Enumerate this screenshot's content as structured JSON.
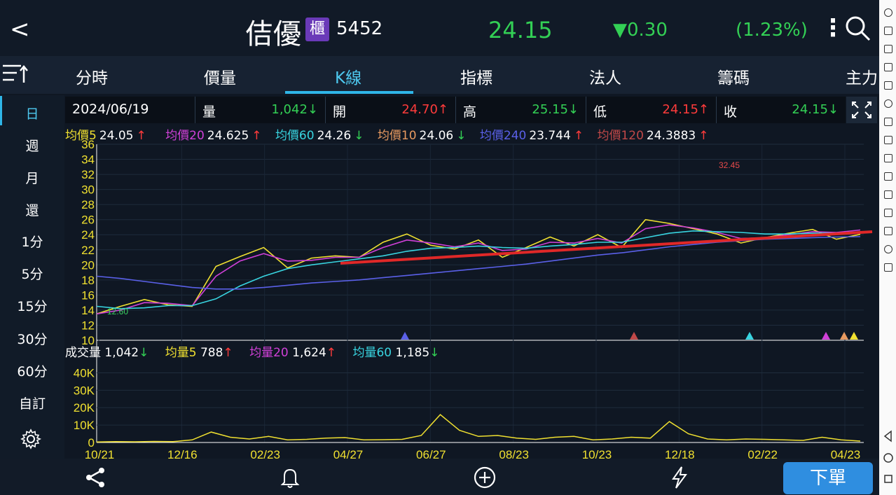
{
  "header": {
    "back": "<",
    "stock_name": "佶優",
    "market_badge": "櫃",
    "code": "5452",
    "price": "24.15",
    "change": "▼0.30",
    "change_pct": "(1.23%)"
  },
  "tabs": [
    "分時",
    "價量",
    "K線",
    "指標",
    "法人",
    "籌碼",
    "主力"
  ],
  "active_tab": "K線",
  "sidebar": [
    "日",
    "週",
    "月",
    "還",
    "1分",
    "5分",
    "15分",
    "30分",
    "60分",
    "自訂"
  ],
  "info": {
    "date": "2024/06/19",
    "volume_label": "量",
    "volume": "1,042↓",
    "open_label": "開",
    "open": "24.70↑",
    "high_label": "高",
    "high": "25.15↓",
    "low_label": "低",
    "low": "24.15↑",
    "close_label": "收",
    "close": "24.15↓"
  },
  "ma": [
    {
      "label": "均價5",
      "value": "24.05",
      "arrow": "↑",
      "color": "#f0e030"
    },
    {
      "label": "均價20",
      "value": "24.625",
      "arrow": "↑",
      "color": "#d040d8"
    },
    {
      "label": "均價60",
      "value": "24.26",
      "arrow": "↓",
      "color": "#38d4e0"
    },
    {
      "label": "均價10",
      "value": "24.06",
      "arrow": "↓",
      "color": "#e89a60"
    },
    {
      "label": "均價240",
      "value": "23.744",
      "arrow": "↑",
      "color": "#5a60e8"
    },
    {
      "label": "均價120",
      "value": "24.3883",
      "arrow": "↑",
      "color": "#c04848"
    }
  ],
  "volume_info": [
    {
      "label": "成交量",
      "value": "1,042",
      "arrow": "↓",
      "color": "#ffffff"
    },
    {
      "label": "均量5",
      "value": "788",
      "arrow": "↑",
      "color": "#f0e030"
    },
    {
      "label": "均量20",
      "value": "1,624",
      "arrow": "↑",
      "color": "#d040d8"
    },
    {
      "label": "均量60",
      "value": "1,185",
      "arrow": "↓",
      "color": "#38d4e0"
    }
  ],
  "bottom": {
    "order_label": "下單"
  },
  "chart_data": {
    "type": "line",
    "x_ticks": [
      "10/21",
      "12/16",
      "02/23",
      "04/27",
      "06/27",
      "08/23",
      "10/23",
      "12/18",
      "02/22",
      "04/23"
    ],
    "price_ticks": [
      "36",
      "34",
      "32",
      "30",
      "28",
      "26",
      "24",
      "22",
      "20",
      "18",
      "16",
      "14",
      "12",
      "10"
    ],
    "ylim": [
      10,
      36
    ],
    "annotations": [
      "32.45",
      "12.60"
    ],
    "volume_ticks": [
      "40K",
      "30K",
      "20K",
      "10K",
      "0"
    ],
    "volume_ylim": [
      0,
      45000
    ],
    "series": [
      {
        "name": "均價5",
        "values": [
          13.5,
          14.5,
          15.4,
          14.7,
          14.5,
          19.8,
          21.1,
          22.3,
          19.6,
          20.9,
          21.2,
          21.0,
          23.0,
          24.1,
          22.6,
          22.1,
          23.3,
          21.0,
          22.3,
          23.7,
          22.5,
          24.0,
          22.3,
          26.0,
          25.5,
          24.8,
          24.1,
          22.9,
          23.6,
          24.2,
          24.7,
          23.4,
          24.05
        ]
      },
      {
        "name": "均價20",
        "values": [
          13.5,
          14.0,
          15.0,
          14.9,
          14.6,
          18.5,
          20.5,
          21.5,
          20.5,
          20.6,
          21.0,
          21.0,
          22.3,
          23.3,
          22.9,
          22.4,
          22.9,
          21.9,
          22.1,
          23.0,
          22.9,
          23.5,
          22.9,
          24.8,
          25.3,
          24.9,
          24.3,
          23.5,
          23.6,
          24.0,
          24.4,
          24.3,
          24.625
        ]
      },
      {
        "name": "均價60",
        "values": [
          14.5,
          14.2,
          14.3,
          14.6,
          14.6,
          15.5,
          17.2,
          18.5,
          19.5,
          20.0,
          20.4,
          20.8,
          21.2,
          21.8,
          22.2,
          22.3,
          22.5,
          22.3,
          22.2,
          22.5,
          22.7,
          23.0,
          23.0,
          23.6,
          24.2,
          24.5,
          24.4,
          24.3,
          24.1,
          24.1,
          24.2,
          24.2,
          24.26
        ]
      },
      {
        "name": "均價240",
        "values": [
          18.5,
          18.2,
          17.8,
          17.4,
          17.0,
          16.8,
          16.8,
          17.0,
          17.3,
          17.6,
          17.8,
          18.0,
          18.3,
          18.6,
          18.9,
          19.2,
          19.5,
          19.8,
          20.1,
          20.5,
          20.9,
          21.3,
          21.6,
          22.0,
          22.4,
          22.7,
          23.0,
          23.2,
          23.4,
          23.5,
          23.6,
          23.7,
          23.744
        ]
      }
    ],
    "volume_series": {
      "name": "均量5",
      "values": [
        300,
        500,
        400,
        600,
        500,
        1500,
        6000,
        3000,
        2000,
        3500,
        1500,
        1800,
        2500,
        2800,
        1500,
        1600,
        1800,
        4000,
        16000,
        7000,
        3500,
        4000,
        2500,
        1800,
        3000,
        3500,
        1500,
        2000,
        3000,
        2500,
        12000,
        5000,
        2000,
        1500,
        2000,
        1800,
        1500,
        1200,
        3000,
        1500,
        788
      ]
    }
  }
}
